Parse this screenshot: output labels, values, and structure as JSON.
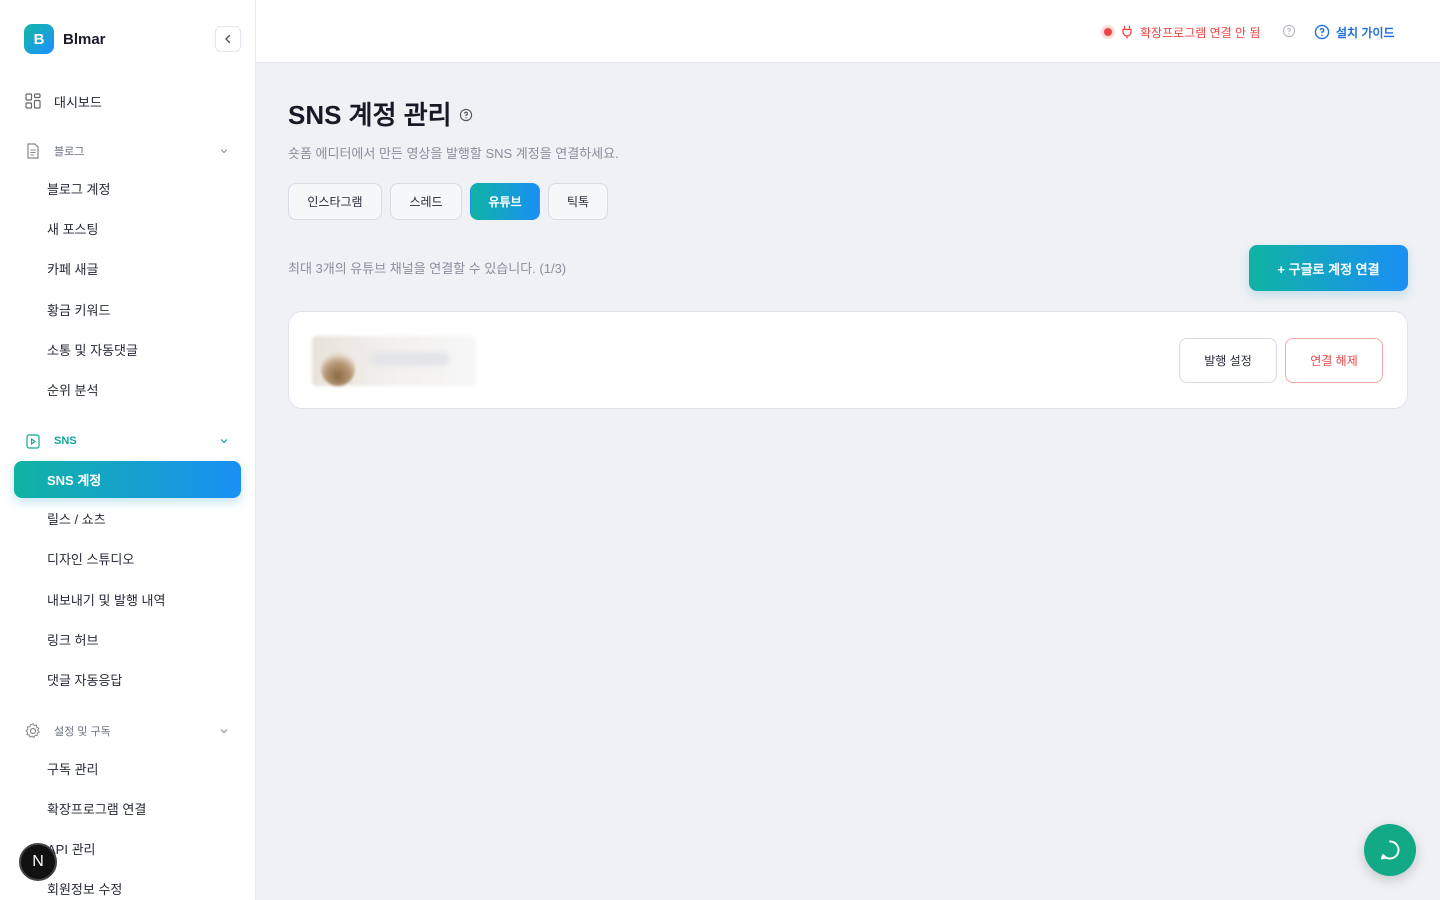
{
  "brand": {
    "logo_letter": "B",
    "name": "Blmar"
  },
  "sidebar": {
    "dashboard_label": "대시보드",
    "sections": [
      {
        "label": "블로그",
        "items": [
          "블로그 계정",
          "새 포스팅",
          "카페 새글",
          "황금 키워드",
          "소통 및 자동댓글",
          "순위 분석"
        ]
      },
      {
        "label": "SNS",
        "items": [
          "SNS 계정",
          "릴스 / 쇼츠",
          "디자인 스튜디오",
          "내보내기 및 발행 내역",
          "링크 허브",
          "댓글 자동응답"
        ]
      },
      {
        "label": "설정 및 구독",
        "items": [
          "구독 관리",
          "확장프로그램 연결",
          "API 관리",
          "회원정보 수정"
        ]
      }
    ],
    "active_item": "SNS 계정",
    "n_badge": "N"
  },
  "topbar": {
    "extension_status": "확장프로그램 연결 안 됨",
    "install_guide": "설치 가이드",
    "status_color": "#ef4444",
    "accent_color": "#1f6fe0"
  },
  "main": {
    "title": "SNS 계정 관리",
    "description": "숏폼 에디터에서 만든 영상을 발행할 SNS 계정을 연결하세요.",
    "tabs": [
      "인스타그램",
      "스레드",
      "유튜브",
      "틱톡"
    ],
    "active_tab": "유튜브",
    "limit_text": "최대 3개의 유튜브 채널을 연결할 수 있습니다. (1/3)",
    "connect_button": "+ 구글로 계정 연결",
    "account": {
      "publish_settings": "발행 설정",
      "disconnect": "연결 해제"
    }
  },
  "colors": {
    "gradient_start": "#10b3a3",
    "gradient_end": "#1a8ff5",
    "chat_fab": "#12a986"
  }
}
